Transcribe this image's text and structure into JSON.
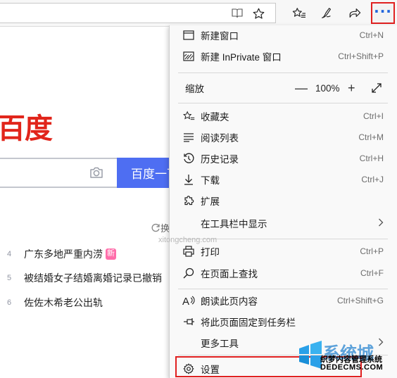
{
  "toolbar": {
    "reader_icon": "reading-view-icon",
    "favorite_icon": "star-icon",
    "favorites_bar_icon": "favorites-icon",
    "notes_icon": "pen-icon",
    "share_icon": "share-icon",
    "more_label": "···"
  },
  "page": {
    "logo_text": "百度",
    "search_button": "百度一下",
    "refresh_text": "换一换",
    "hot_list": [
      {
        "num": "4",
        "title": "广东多地严重内涝",
        "badge": "新"
      },
      {
        "num": "5",
        "title": "被结婚女子结婚离婚记录已撤销",
        "badge": ""
      },
      {
        "num": "6",
        "title": "佐佐木希老公出轨",
        "badge": ""
      }
    ]
  },
  "menu": {
    "new_window": {
      "label": "新建窗口",
      "shortcut": "Ctrl+N"
    },
    "new_inprivate": {
      "label": "新建 InPrivate 窗口",
      "shortcut": "Ctrl+Shift+P"
    },
    "zoom": {
      "label": "缩放",
      "minus": "—",
      "value": "100%",
      "plus": "+"
    },
    "favorites": {
      "label": "收藏夹",
      "shortcut": "Ctrl+I"
    },
    "reading_list": {
      "label": "阅读列表",
      "shortcut": "Ctrl+M"
    },
    "history": {
      "label": "历史记录",
      "shortcut": "Ctrl+H"
    },
    "downloads": {
      "label": "下载",
      "shortcut": "Ctrl+J"
    },
    "extensions": {
      "label": "扩展",
      "shortcut": ""
    },
    "show_in_toolbar": {
      "label": "在工具栏中显示",
      "shortcut": ""
    },
    "print": {
      "label": "打印",
      "shortcut": "Ctrl+P"
    },
    "find_on_page": {
      "label": "在页面上查找",
      "shortcut": "Ctrl+F"
    },
    "read_aloud": {
      "label": "朗读此页内容",
      "shortcut": "Ctrl+Shift+G"
    },
    "pin_taskbar": {
      "label": "将此页面固定到任务栏",
      "shortcut": ""
    },
    "more_tools": {
      "label": "更多工具",
      "shortcut": ""
    },
    "settings": {
      "label": "设置",
      "shortcut": ""
    }
  },
  "watermark": {
    "big": "系统城",
    "line1": "织梦内容管理系统",
    "line2": "DEDECMS.COM",
    "sub": "xitongcheng.com"
  },
  "colors": {
    "highlight_red": "#e02020",
    "baidu_red": "#e1251b",
    "baidu_blue": "#4e6ef2",
    "edge_blue": "#2266dd"
  }
}
